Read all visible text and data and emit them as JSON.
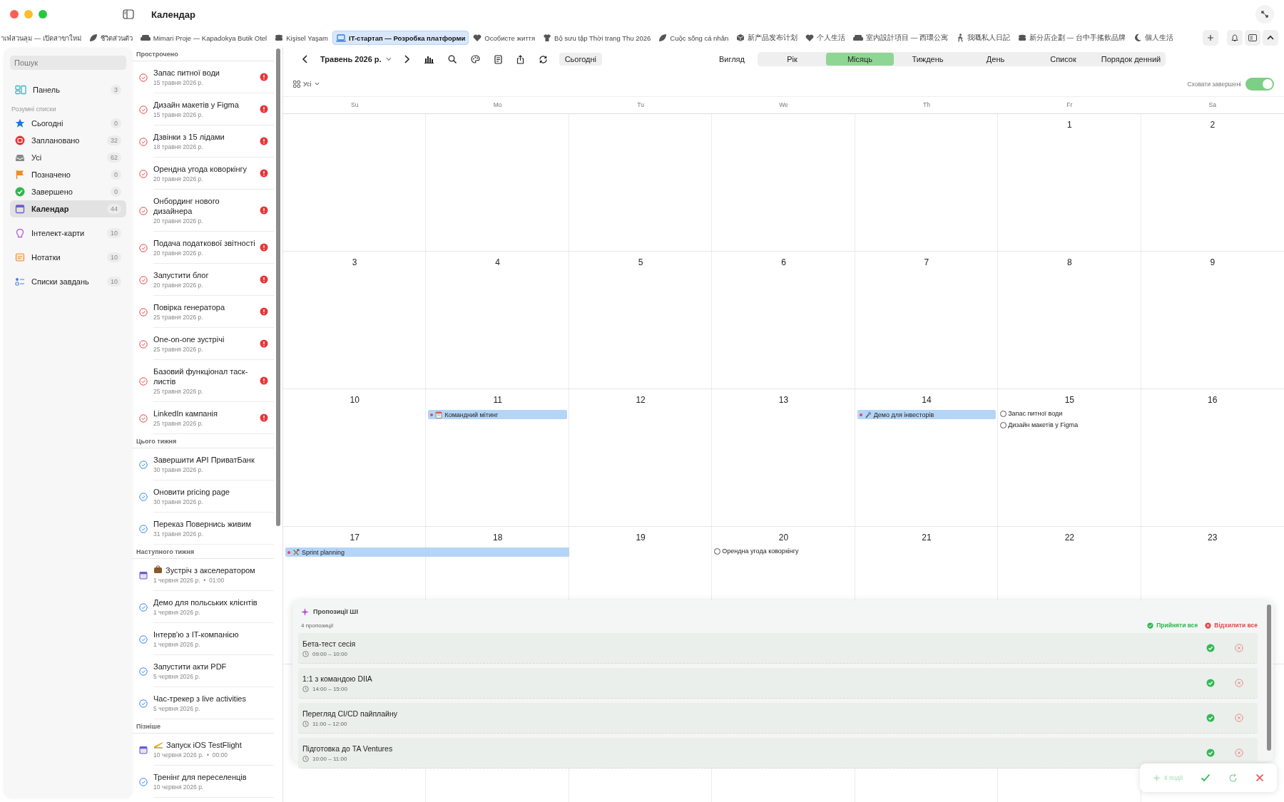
{
  "window": {
    "title": "Календар"
  },
  "tabs": [
    {
      "label": "าเฟ่สวนลุม — เปิดสาขาใหม่",
      "selected": false
    },
    {
      "label": "ชีวิตส่วนตัว",
      "selected": false
    },
    {
      "label": "Mimari Proje — Kapadokya Butik Otel",
      "selected": false
    },
    {
      "label": "Kişisel Yaşam",
      "selected": false
    },
    {
      "label": "IT-стартап — Розробка платформи",
      "selected": true
    },
    {
      "label": "Особисте життя",
      "selected": false
    },
    {
      "label": "Bộ sưu tập Thời trang Thu 2026",
      "selected": false
    },
    {
      "label": "Cuộc sống cá nhân",
      "selected": false
    },
    {
      "label": "新产品发布计划",
      "selected": false
    },
    {
      "label": "个人生活",
      "selected": false
    },
    {
      "label": "室內設計項目 — 西環公寓",
      "selected": false
    },
    {
      "label": "我嘅私人日記",
      "selected": false
    },
    {
      "label": "新分店企劃 — 台中手搖飲品牌",
      "selected": false
    },
    {
      "label": "個人生活",
      "selected": false
    }
  ],
  "sidebar": {
    "search": {
      "placeholder": "Пошук"
    },
    "groups": [
      {
        "items": [
          {
            "label": "Панель",
            "count": "3",
            "selected": false
          }
        ]
      },
      {
        "title": "Розумні списки",
        "items": [
          {
            "label": "Сьогодні",
            "count": "0",
            "selected": false
          },
          {
            "label": "Заплановано",
            "count": "32",
            "selected": false
          },
          {
            "label": "Усі",
            "count": "62",
            "selected": false
          },
          {
            "label": "Позначено",
            "count": "0",
            "selected": false
          },
          {
            "label": "Завершено",
            "count": "0",
            "selected": false
          },
          {
            "label": "Календар",
            "count": "44",
            "selected": true
          }
        ]
      },
      {
        "items": [
          {
            "label": "Інтелект-карти",
            "count": "10",
            "selected": false
          }
        ]
      },
      {
        "items": [
          {
            "label": "Нотатки",
            "count": "10",
            "selected": false
          }
        ]
      },
      {
        "items": [
          {
            "label": "Списки завдань",
            "count": "10",
            "selected": false
          }
        ]
      }
    ]
  },
  "task_sections": [
    {
      "title": "Прострочено",
      "tasks": [
        {
          "kind": "task",
          "title": "Запас питної води",
          "date": "15 травня 2026 р.",
          "overdue": true
        },
        {
          "kind": "task",
          "title": "Дизайн макетів у Figma",
          "date": "15 травня 2026 р.",
          "overdue": true
        },
        {
          "kind": "task",
          "title": "Дзвінки з 15 лідами",
          "date": "18 травня 2026 р.",
          "overdue": true
        },
        {
          "kind": "task",
          "title": "Орендна угода коворкінгу",
          "date": "20 травня 2026 р.",
          "overdue": true
        },
        {
          "kind": "task",
          "title": "Онбординг нового дизайнера",
          "date": "20 травня 2026 р.",
          "overdue": true
        },
        {
          "kind": "task",
          "title": "Подача податкової звітності",
          "date": "20 травня 2026 р.",
          "overdue": true
        },
        {
          "kind": "task",
          "title": "Запустити блог",
          "date": "20 травня 2026 р.",
          "overdue": true
        },
        {
          "kind": "task",
          "title": "Повірка генератора",
          "date": "25 травня 2026 р.",
          "overdue": true
        },
        {
          "kind": "task",
          "title": "One-on-one зустрічі",
          "date": "25 травня 2026 р.",
          "overdue": true
        },
        {
          "kind": "task",
          "title": "Базовий функціонал таск-листів",
          "date": "25 травня 2026 р.",
          "overdue": true
        },
        {
          "kind": "task",
          "title": "LinkedIn кампанія",
          "date": "25 травня 2026 р.",
          "overdue": true
        }
      ]
    },
    {
      "title": "Цього тижня",
      "tasks": [
        {
          "kind": "task",
          "title": "Завершити API ПриватБанк",
          "date": "30 травня 2026 р.",
          "overdue": false
        },
        {
          "kind": "task",
          "title": "Оновити pricing page",
          "date": "30 травня 2026 р.",
          "overdue": false
        },
        {
          "kind": "task",
          "title": "Переказ Повернись живим",
          "date": "31 травня 2026 р.",
          "overdue": false
        }
      ]
    },
    {
      "title": "Наступного тижня",
      "tasks": [
        {
          "kind": "event",
          "title": "Зустріч з акселератором",
          "date": "1 червня 2026 р.  •  01:00",
          "overdue": false
        },
        {
          "kind": "task",
          "title": "Демо для польських клієнтів",
          "date": "1 червня 2026 р.",
          "overdue": false
        },
        {
          "kind": "task",
          "title": "Інтерв'ю з IT-компанією",
          "date": "1 червня 2026 р.",
          "overdue": false
        },
        {
          "kind": "task",
          "title": "Запустити акти PDF",
          "date": "5 червня 2026 р.",
          "overdue": false
        },
        {
          "kind": "task",
          "title": "Час-трекер з live activities",
          "date": "5 червня 2026 р.",
          "overdue": false
        }
      ]
    },
    {
      "title": "Пізніше",
      "tasks": [
        {
          "kind": "event",
          "title": "Запуск iOS TestFlight",
          "date": "10 червня 2026 р.  •  00:00",
          "overdue": false
        },
        {
          "kind": "task",
          "title": "Тренінг для переселенців",
          "date": "10 червня 2026 р.",
          "overdue": false
        }
      ]
    }
  ],
  "calendar": {
    "month": "Травень 2026 р.",
    "today_button": "Сьогодні",
    "view_label": "Вигляд",
    "views": [
      {
        "label": "Рік",
        "selected": false
      },
      {
        "label": "Місяць",
        "selected": true
      },
      {
        "label": "Тиждень",
        "selected": false
      },
      {
        "label": "День",
        "selected": false
      },
      {
        "label": "Список",
        "selected": false
      },
      {
        "label": "Порядок денний",
        "selected": false
      }
    ],
    "filter": "Усі",
    "hide_completed": {
      "label": "Сховати завершені",
      "on": true
    },
    "weekdays": [
      "Su",
      "Mo",
      "Tu",
      "We",
      "Th",
      "Fr",
      "Sa"
    ],
    "weeks": [
      {
        "days": [
          {
            "date": "1"
          },
          {
            "date": "2"
          }
        ]
      },
      {
        "days": [
          {
            "date": "3"
          },
          {
            "date": "4"
          },
          {
            "date": "5"
          },
          {
            "date": "6"
          },
          {
            "date": "7"
          },
          {
            "date": "8"
          },
          {
            "date": "9"
          }
        ]
      },
      {
        "days": [
          {
            "date": "10"
          },
          {
            "date": "11",
            "items": [
              {
                "kind": "event",
                "title": "Командний мітинг",
                "continues_next_day": false
              }
            ]
          },
          {
            "date": "12"
          },
          {
            "date": "13"
          },
          {
            "date": "14",
            "items": [
              {
                "kind": "event",
                "title": "Демо для інвесторів",
                "continues_next_day": false
              }
            ]
          },
          {
            "date": "15",
            "items": [
              {
                "kind": "task",
                "title": "Запас питної води"
              },
              {
                "kind": "task",
                "title": "Дизайн макетів у Figma"
              }
            ]
          },
          {
            "date": "16"
          }
        ]
      },
      {
        "days": [
          {
            "date": "17",
            "items": [
              {
                "kind": "event",
                "title": "Sprint planning",
                "continues_next_day": true
              }
            ]
          },
          {
            "date": "18"
          },
          {
            "date": "19"
          },
          {
            "date": "20",
            "items": [
              {
                "kind": "task",
                "title": "Орендна угода коворкінгу"
              }
            ]
          },
          {
            "date": "21"
          },
          {
            "date": "22"
          },
          {
            "date": "23"
          }
        ]
      }
    ]
  },
  "ai_panel": {
    "title": "Пропозиції ШІ",
    "count": "4 пропозиції",
    "accept_all": "Прийняти все",
    "reject_all": "Відхилити все",
    "proposals": [
      {
        "title": "Бета-тест сесія",
        "time": "09:00 – 10:00"
      },
      {
        "title": "1:1 з командою DIIA",
        "time": "14:00 – 15:00"
      },
      {
        "title": "Перегляд CI/CD пайплайну",
        "time": "11:00 – 12:00"
      },
      {
        "title": "Підготовка до TA Ventures",
        "time": "10:00 – 11:00"
      }
    ]
  },
  "floating_bar": {
    "label": "4 події"
  }
}
